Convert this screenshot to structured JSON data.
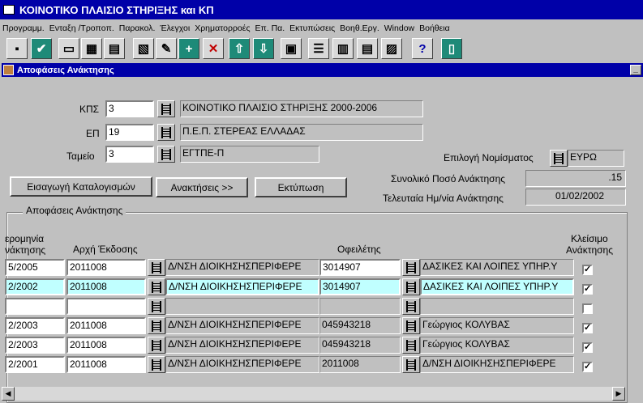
{
  "window_title": "ΚΟΙΝΟΤΙΚΟ ΠΛΑΙΣΙΟ ΣΤΗΡΙΞΗΣ και ΚΠ",
  "menu": [
    "Προγραμμ.",
    "Ενταξη /Τροπoπ.",
    "Παρακολ.",
    "Έλεγχοι",
    "Χρηματορροές",
    "Επ. Πα.",
    "Εκτυπώσεις",
    "Βοηθ.Εργ.",
    "Window",
    "Βοήθεια"
  ],
  "subwindow_title": "Αποφάσεις Ανάκτησης",
  "header": {
    "kps": {
      "label": "ΚΠΣ",
      "code": "3",
      "desc": "ΚΟΙΝΟΤΙΚΟ ΠΛΑΙΣΙΟ ΣΤΗΡΙΞΗΣ 2000-2006"
    },
    "ep": {
      "label": "ΕΠ",
      "code": "19",
      "desc": "Π.Ε.Π. ΣΤΕΡΕΑΣ ΕΛΛΑΔΑΣ"
    },
    "tameio": {
      "label": "Ταμείο",
      "code": "3",
      "desc": "ΕΓΤΠΕ-Π"
    },
    "currency": {
      "label": "Επιλογή Νομίσματος",
      "value": "ΕΥΡΩ"
    },
    "total": {
      "label": "Συνολικό Ποσό Ανάκτησης",
      "value": ".15"
    },
    "last_date": {
      "label": "Τελευταία Ημ/νία Ανάκτησης",
      "value": "01/02/2002"
    }
  },
  "buttons": {
    "import": "Εισαγωγή Καταλογισμών",
    "recoveries": "Ανακτήσεις >>",
    "print": "Εκτύπωση"
  },
  "group_title": "Αποφάσεις Ανάκτησης",
  "columns": {
    "date_line1": "ερομηνία",
    "date_line2": "νάκτησης",
    "authority": "Αρχή Έκδοσης",
    "debtors": "Οφειλέτης",
    "close_line1": "Κλείσιμο",
    "close_line2": "Ανάκτησης"
  },
  "rows": [
    {
      "date": "5/2005",
      "code": "2011008",
      "authority": "Δ/ΝΣΗ ΔΙΟΙΚΗΣΗΣΠΕΡΙΦΕΡΕ",
      "debtor_code": "3014907",
      "debtor": "ΔΑΣΙΚΕΣ ΚΑΙ ΛΟΙΠΕΣ ΥΠΗΡ.Υ",
      "closed": "✓"
    },
    {
      "date": "2/2002",
      "code": "2011008",
      "authority": "Δ/ΝΣΗ ΔΙΟΙΚΗΣΗΣΠΕΡΙΦΕΡΕ",
      "debtor_code": "3014907",
      "debtor": "ΔΑΣΙΚΕΣ ΚΑΙ ΛΟΙΠΕΣ ΥΠΗΡ.Υ",
      "closed": "✓"
    },
    {
      "date": "",
      "code": "",
      "authority": "",
      "debtor_code": "",
      "debtor": "",
      "closed": ""
    },
    {
      "date": "2/2003",
      "code": "2011008",
      "authority": "Δ/ΝΣΗ ΔΙΟΙΚΗΣΗΣΠΕΡΙΦΕΡΕ",
      "debtor_code": "045943218",
      "debtor": "Γεώργιος ΚΟΛΥΒΑΣ",
      "closed": "✓"
    },
    {
      "date": "2/2003",
      "code": "2011008",
      "authority": "Δ/ΝΣΗ ΔΙΟΙΚΗΣΗΣΠΕΡΙΦΕΡΕ",
      "debtor_code": "045943218",
      "debtor": "Γεώργιος ΚΟΛΥΒΑΣ",
      "closed": "✓"
    },
    {
      "date": "2/2001",
      "code": "2011008",
      "authority": "Δ/ΝΣΗ ΔΙΟΙΚΗΣΗΣΠΕΡΙΦΕΡΕ",
      "debtor_code": "2011008",
      "debtor": "Δ/ΝΣΗ ΔΙΟΙΚΗΣΗΣΠΕΡΙΦΕΡΕ",
      "closed": "✓"
    }
  ],
  "toolbar_icons": [
    "save-icon",
    "commit-check-icon",
    "copy-record-icon",
    "clear-record-icon",
    "duplicate-icon",
    "query-icon",
    "edit-icon",
    "insert-record-icon",
    "delete-record-icon",
    "previous-record-icon",
    "next-record-icon",
    "print-icon",
    "list-icon",
    "report-icon",
    "document-icon",
    "clipboard-icon",
    "help-icon",
    "exit-icon"
  ],
  "toolbar_glyphs": {
    "help": "?",
    "insert": "+",
    "delete": "✕",
    "up": "⇧",
    "down": "⇩",
    "check": "✔"
  },
  "colors": {
    "title_bar": "#0000a8",
    "selected_row": "#c0ffff",
    "toolbar_teal": "#1e8a78"
  }
}
